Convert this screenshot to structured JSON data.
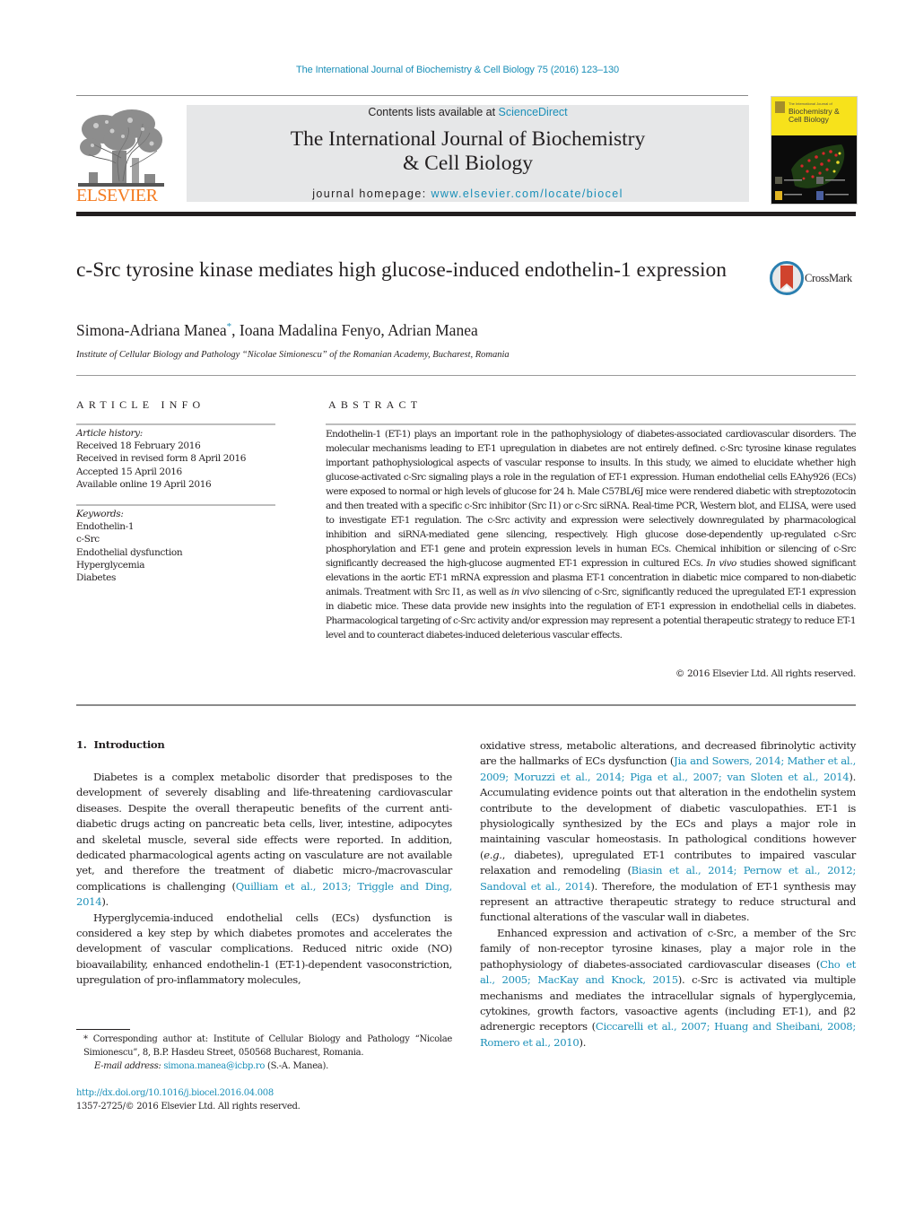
{
  "running_head": "The International Journal of Biochemistry & Cell Biology 75 (2016) 123–130",
  "masthead": {
    "publisher_logo_text": "ELSEVIER",
    "contents_prefix": "Contents lists available at ",
    "contents_link": "ScienceDirect",
    "journal_title_line1": "The International Journal of Biochemistry",
    "journal_title_line2": "& Cell Biology",
    "homepage_prefix": "journal homepage: ",
    "homepage_link": "www.elsevier.com/locate/biocel",
    "cover": {
      "small_text": "The International Journal of",
      "title_line1": "Biochemistry &",
      "title_line2": "Cell Biology"
    }
  },
  "article": {
    "title": "c-Src tyrosine kinase mediates high glucose-induced endothelin-1 expression",
    "crossmark_label": "CrossMark",
    "authors": [
      {
        "name": "Simona-Adriana Manea",
        "marker": "*"
      },
      {
        "name": "Ioana Madalina Fenyo",
        "marker": ""
      },
      {
        "name": "Adrian Manea",
        "marker": ""
      }
    ],
    "author_sep": ", ",
    "affiliation": "Institute of Cellular Biology and Pathology “Nicolae Simionescu” of the Romanian Academy, Bucharest, Romania"
  },
  "article_info": {
    "heading": "ARTICLE INFO",
    "history_label": "Article history:",
    "history": [
      "Received 18 February 2016",
      "Received in revised form 8 April 2016",
      "Accepted 15 April 2016",
      "Available online 19 April 2016"
    ],
    "keywords_label": "Keywords:",
    "keywords": [
      "Endothelin-1",
      "c-Src",
      "Endothelial dysfunction",
      "Hyperglycemia",
      "Diabetes"
    ]
  },
  "abstract": {
    "heading": "ABSTRACT",
    "segments": [
      {
        "t": "Endothelin-1 (ET-1) plays an important role in the pathophysiology of diabetes-associated cardiovascular disorders. The molecular mechanisms leading to ET-1 upregulation in diabetes are not entirely defined. c-Src tyrosine kinase regulates important pathophysiological aspects of vascular response to insults. In this study, we aimed to elucidate whether high glucose-activated c-Src signaling plays a role in the regulation of ET-1 expression. Human endothelial cells EAhy926 (ECs) were exposed to normal or high levels of glucose for 24 h. Male C57BL/6J mice were rendered diabetic with streptozotocin and then treated with a specific c-Src inhibitor (Src I1) or c-Src siRNA. Real-time PCR, Western blot, and ELISA, were used to investigate ET-1 regulation. The c-Src activity and expression were selectively downregulated by pharmacological inhibition and siRNA-mediated gene silencing, respectively. High glucose dose-dependently up-regulated c-Src phosphorylation and ET-1 gene and protein expression levels in human ECs. Chemical inhibition or silencing of c-Src significantly decreased the high-glucose augmented ET-1 expression in cultured ECs. ",
        "i": false
      },
      {
        "t": "In vivo",
        "i": true
      },
      {
        "t": " studies showed significant elevations in the aortic ET-1 mRNA expression and plasma ET-1 concentration in diabetic mice compared to non-diabetic animals. Treatment with Src I1, as well as ",
        "i": false
      },
      {
        "t": "in vivo",
        "i": true
      },
      {
        "t": " silencing of c-Src, significantly reduced the upregulated ET-1 expression in diabetic mice. These data provide new insights into the regulation of ET-1 expression in endothelial cells in diabetes. Pharmacological targeting of c-Src activity and/or expression may represent a potential therapeutic strategy to reduce ET-1 level and to counteract diabetes-induced deleterious vascular effects.",
        "i": false
      }
    ],
    "copyright": "© 2016 Elsevier Ltd. All rights reserved."
  },
  "introduction": {
    "number": "1.",
    "heading": "Introduction",
    "left_paragraphs": [
      {
        "indent": true,
        "segments": [
          {
            "t": "Diabetes is a complex metabolic disorder that predisposes to the development of severely disabling and life-threatening cardiovascular diseases. Despite the overall therapeutic benefits of the current anti-diabetic drugs acting on pancreatic beta cells, liver, intestine, adipocytes and skeletal muscle, several side effects were reported. In addition, dedicated pharmacological agents acting on vasculature are not available yet, and therefore the treatment of diabetic micro-/macrovascular complications is challenging (",
            "k": "text"
          },
          {
            "t": "Quilliam et al., 2013; Triggle and Ding, 2014",
            "k": "link"
          },
          {
            "t": ").",
            "k": "text"
          }
        ]
      },
      {
        "indent": true,
        "segments": [
          {
            "t": "Hyperglycemia-induced endothelial cells (ECs) dysfunction is considered a key step by which diabetes promotes and accelerates the development of vascular complications. Reduced nitric oxide (NO) bioavailability, enhanced endothelin-1 (ET-1)-dependent vasoconstriction, upregulation of pro-inflammatory molecules,",
            "k": "text"
          }
        ]
      }
    ],
    "right_paragraphs": [
      {
        "indent": false,
        "segments": [
          {
            "t": "oxidative stress, metabolic alterations, and decreased fibrinolytic activity are the hallmarks of ECs dysfunction (",
            "k": "text"
          },
          {
            "t": "Jia and Sowers, 2014; Mather et al., 2009; Moruzzi et al., 2014; Piga et al., 2007; van Sloten et al., 2014",
            "k": "link"
          },
          {
            "t": "). Accumulating evidence points out that alteration in the endothelin system contribute to the development of diabetic vasculopathies. ET-1 is physiologically synthesized by the ECs and plays a major role in maintaining vascular homeostasis. In pathological conditions however (",
            "k": "text"
          },
          {
            "t": "e.g.",
            "k": "italic"
          },
          {
            "t": ", diabetes), upregulated ET-1 contributes to impaired vascular relaxation and remodeling (",
            "k": "text"
          },
          {
            "t": "Biasin et al., 2014; Pernow et al., 2012; Sandoval et al., 2014",
            "k": "link"
          },
          {
            "t": "). Therefore, the modulation of ET-1 synthesis may represent an attractive therapeutic strategy to reduce structural and functional alterations of the vascular wall in diabetes.",
            "k": "text"
          }
        ]
      },
      {
        "indent": true,
        "segments": [
          {
            "t": "Enhanced expression and activation of c-Src, a member of the Src family of non-receptor tyrosine kinases, play a major role in the pathophysiology of diabetes-associated cardiovascular diseases (",
            "k": "text"
          },
          {
            "t": "Cho et al., 2005; MacKay and Knock, 2015",
            "k": "link"
          },
          {
            "t": "). c-Src is activated via multiple mechanisms and mediates the intracellular signals of hyperglycemia, cytokines, growth factors, vasoactive agents (including ET-1), and β2 adrenergic receptors (",
            "k": "text"
          },
          {
            "t": "Ciccarelli et al., 2007; Huang and Sheibani, 2008; Romero et al., 2010",
            "k": "link"
          },
          {
            "t": ").",
            "k": "text"
          }
        ]
      }
    ]
  },
  "footnote": {
    "marker": "*",
    "corresponding": " Corresponding author at: Institute of Cellular Biology and Pathology “Nicolae Simionescu”, 8, B.P. Hasdeu Street, 050568 Bucharest, Romania.",
    "email_label": "E-mail address:",
    "email": "simona.manea@icbp.ro",
    "email_suffix": " (S.-A. Manea)."
  },
  "doi": "http://dx.doi.org/10.1016/j.biocel.2016.04.008",
  "issn_line": "1357-2725/© 2016 Elsevier Ltd. All rights reserved.",
  "colors": {
    "link": "#1a8fb8",
    "elsevier_orange": "#f47b20",
    "masthead_gray": "#e6e7e8",
    "cover_yellow": "#f7e21b",
    "text": "#231f20"
  }
}
